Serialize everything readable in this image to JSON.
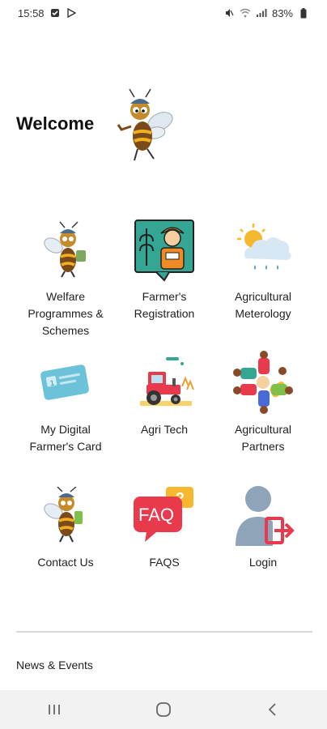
{
  "status_bar": {
    "time": "15:58",
    "battery": "83%"
  },
  "header": {
    "title": "Welcome"
  },
  "tiles": [
    {
      "label": "Welfare Programmes & Schemes",
      "icon": "bee-farmer-icon"
    },
    {
      "label": "Farmer's Registration",
      "icon": "farmer-registration-icon"
    },
    {
      "label": "Agricultural Meterology",
      "icon": "weather-cloud-icon"
    },
    {
      "label": "My Digital Farmer's Card",
      "icon": "card-icon"
    },
    {
      "label": "Agri Tech",
      "icon": "tractor-icon"
    },
    {
      "label": "Agricultural Partners",
      "icon": "partners-icon"
    },
    {
      "label": "Contact Us",
      "icon": "bee-contact-icon"
    },
    {
      "label": "FAQS",
      "icon": "faq-icon"
    },
    {
      "label": "Login",
      "icon": "login-icon"
    }
  ],
  "news": {
    "title": "News & Events"
  },
  "colors": {
    "accent_red": "#e8394d",
    "accent_yellow": "#f5b82e",
    "teal": "#2f9c8f",
    "nav_bg": "#f2f2f2"
  }
}
